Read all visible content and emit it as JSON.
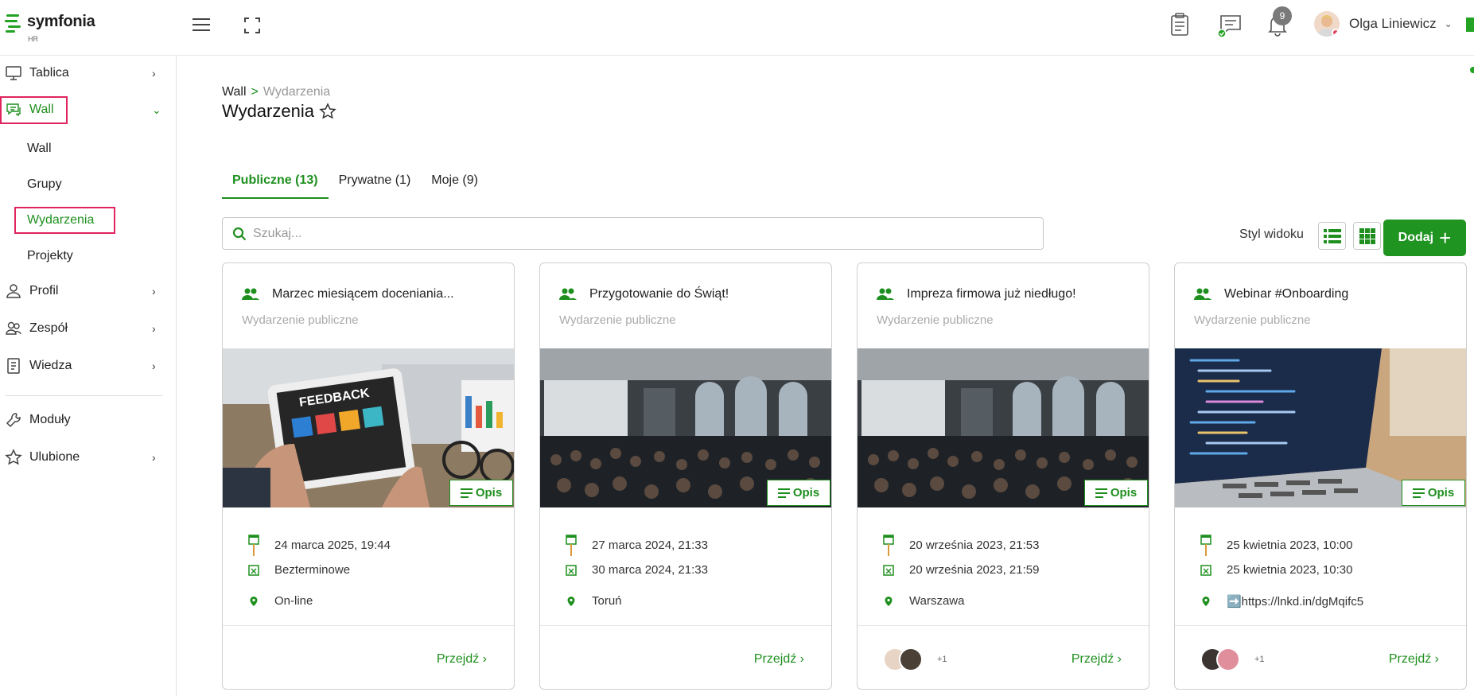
{
  "app": {
    "name": "symfonia",
    "sub": "HR"
  },
  "header": {
    "notifications_count": "9",
    "user_name": "Olga Liniewicz"
  },
  "sidebar": {
    "tablica": "Tablica",
    "wall": "Wall",
    "wall_sub": [
      "Wall",
      "Grupy",
      "Wydarzenia",
      "Projekty"
    ],
    "profil": "Profil",
    "zespol": "Zespół",
    "wiedza": "Wiedza",
    "moduly": "Moduły",
    "ulubione": "Ulubione"
  },
  "breadcrumb": {
    "parent": "Wall",
    "sep": ">",
    "current": "Wydarzenia"
  },
  "page_title": "Wydarzenia",
  "tabs": [
    "Publiczne (13)",
    "Prywatne (1)",
    "Moje (9)"
  ],
  "search": {
    "placeholder": "Szukaj..."
  },
  "view_style_label": "Styl widoku",
  "add_button": "Dodaj",
  "opis_label": "Opis",
  "go_label": "Przejdź",
  "colors": {
    "accent": "#1e8f1e",
    "highlight": "#e0245e"
  },
  "cards": [
    {
      "title": "Marzec miesiącem doceniania...",
      "type": "Wydarzenie publiczne",
      "start": "24 marca 2025, 19:44",
      "end": "Bezterminowe",
      "location": "On-line",
      "image_text": "FEEDBACK",
      "extra": ""
    },
    {
      "title": "Przygotowanie do Świąt!",
      "type": "Wydarzenie publiczne",
      "start": "27 marca 2024, 21:33",
      "end": "30 marca 2024, 21:33",
      "location": "Toruń",
      "extra": ""
    },
    {
      "title": "Impreza firmowa już niedługo!",
      "type": "Wydarzenie publiczne",
      "start": "20 września 2023, 21:53",
      "end": "20 września 2023, 21:59",
      "location": "Warszawa",
      "extra": "+1"
    },
    {
      "title": "Webinar #Onboarding",
      "type": "Wydarzenie publiczne",
      "start": "25 kwietnia 2023, 10:00",
      "end": "25 kwietnia 2023, 10:30",
      "location": "➡️https://lnkd.in/dgMqifc5",
      "extra": "+1"
    }
  ]
}
